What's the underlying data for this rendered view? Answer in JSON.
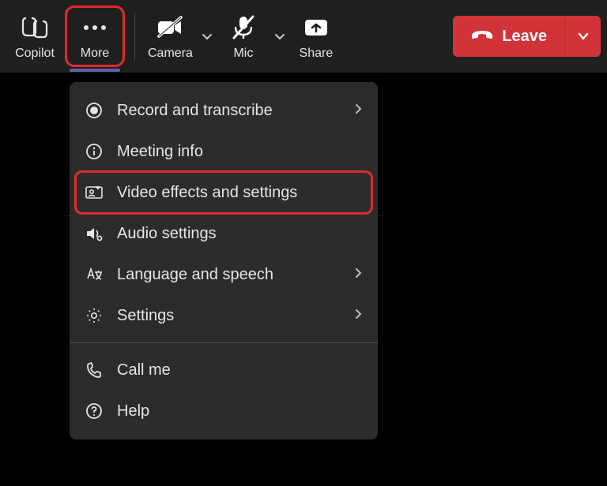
{
  "toolbar": {
    "copilot": {
      "label": "Copilot"
    },
    "more": {
      "label": "More"
    },
    "camera": {
      "label": "Camera"
    },
    "mic": {
      "label": "Mic"
    },
    "share": {
      "label": "Share"
    },
    "leave": {
      "label": "Leave"
    }
  },
  "menu": {
    "record": {
      "label": "Record and transcribe"
    },
    "info": {
      "label": "Meeting info"
    },
    "video_fx": {
      "label": "Video effects and settings"
    },
    "audio": {
      "label": "Audio settings"
    },
    "lang": {
      "label": "Language and speech"
    },
    "settings": {
      "label": "Settings"
    },
    "callme": {
      "label": "Call me"
    },
    "help": {
      "label": "Help"
    }
  },
  "colors": {
    "highlight": "#e22b2b",
    "leave_bg": "#d13438",
    "accent_underline": "#6264a7"
  }
}
